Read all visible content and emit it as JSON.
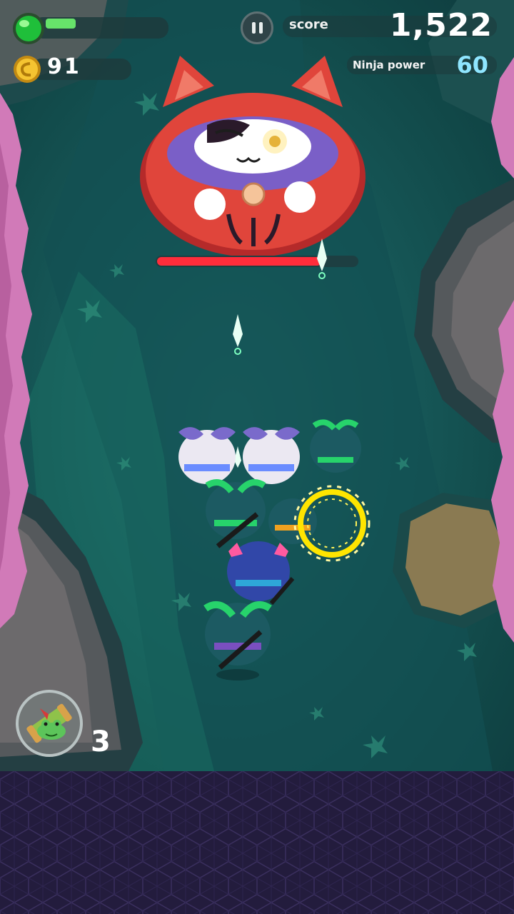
{
  "hud": {
    "score_label": "score",
    "score_value": "1,522",
    "ninja_power_label": "Ninja power",
    "ninja_power_value": "60",
    "coin_count": "91",
    "player_health_fraction": 0.25,
    "boss_health_fraction": 0.82
  },
  "item": {
    "icon": "frog-scroll-icon",
    "count": "3"
  },
  "colors": {
    "boss_red": "#e0453b",
    "boss_health": "#ff2d3b",
    "ninja_power": "#8fe6ff",
    "blossom": "#d17ab8",
    "bottom_panel": "#231c3d"
  }
}
